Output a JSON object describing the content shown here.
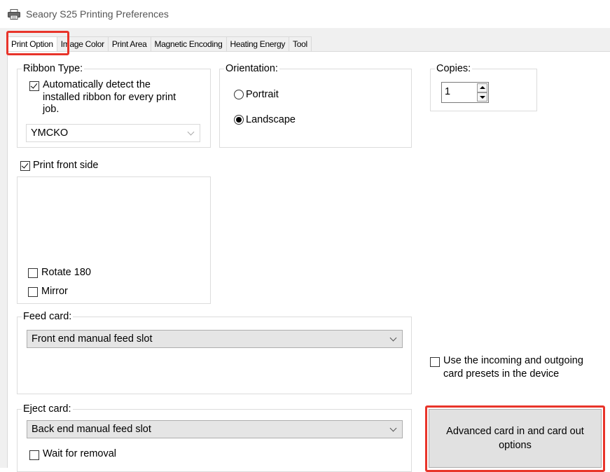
{
  "window": {
    "title": "Seaory S25 Printing Preferences",
    "icon": "printer-icon"
  },
  "tabs": [
    {
      "label": "Print Option",
      "active": true
    },
    {
      "label": "Image Color",
      "active": false
    },
    {
      "label": "Print Area",
      "active": false
    },
    {
      "label": "Magnetic Encoding",
      "active": false
    },
    {
      "label": "Heating Energy",
      "active": false
    },
    {
      "label": "Tool",
      "active": false
    }
  ],
  "ribbon": {
    "group_label": "Ribbon Type:",
    "auto_detect_label": "Automatically detect the installed ribbon for every print job.",
    "auto_detect_line1": "Automatically detect the",
    "auto_detect_line2": "installed ribbon for every print",
    "auto_detect_line3": "job.",
    "auto_detect_checked": true,
    "type_value": "YMCKO"
  },
  "orientation": {
    "group_label": "Orientation:",
    "portrait_label": "Portrait",
    "landscape_label": "Landscape",
    "selected": "Landscape"
  },
  "copies": {
    "group_label": "Copies:",
    "value": "1"
  },
  "front_side": {
    "label": "Print front side",
    "checked": true,
    "rotate_label": "Rotate 180",
    "rotate_checked": false,
    "mirror_label": "Mirror",
    "mirror_checked": false
  },
  "feed_card": {
    "group_label": "Feed card:",
    "value": "Front end manual feed slot"
  },
  "eject_card": {
    "group_label": "Eject card:",
    "value": "Back end manual feed slot",
    "wait_label": "Wait for removal",
    "wait_checked": false
  },
  "presets": {
    "label_line1": "Use the incoming and outgoing",
    "label_line2": "card presets in the device",
    "checked": false
  },
  "advanced_button": {
    "line1": "Advanced card in and card out",
    "line2": "options"
  },
  "colors": {
    "highlight": "#e8342a",
    "dialog_bg": "#f0f0f0",
    "panel_bg": "#ffffff"
  }
}
